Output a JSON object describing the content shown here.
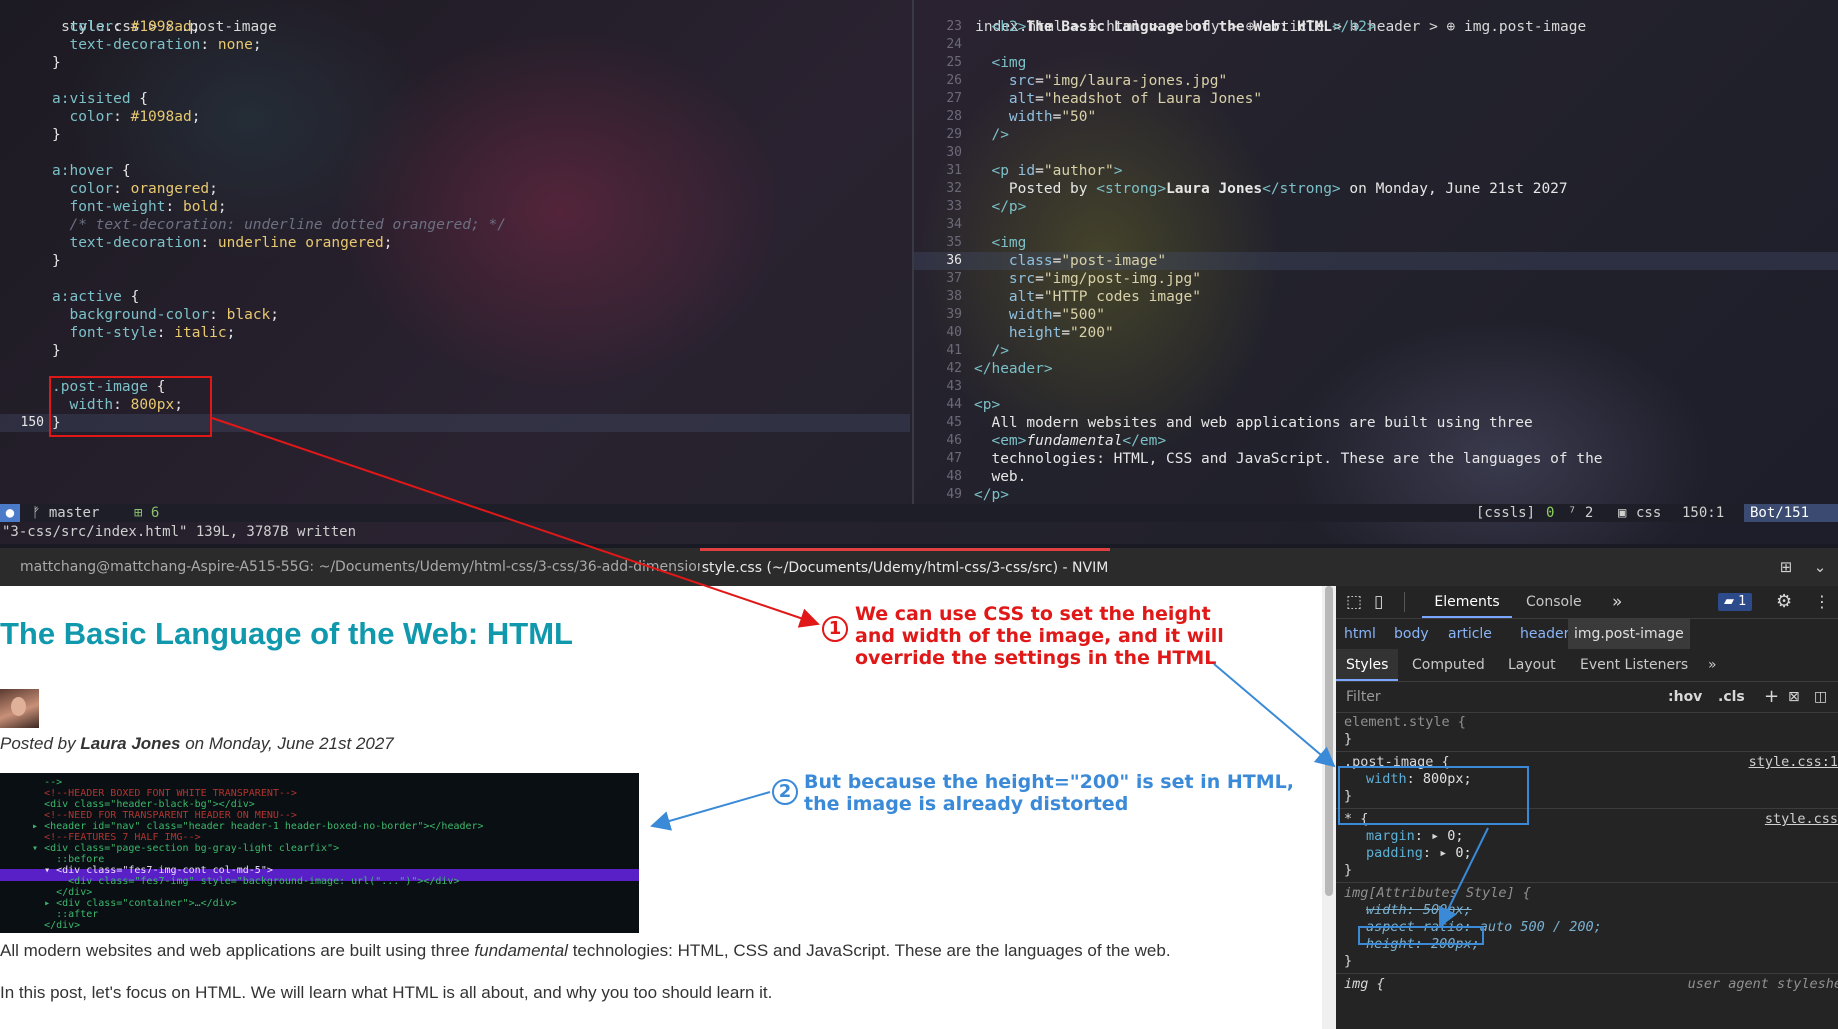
{
  "editor": {
    "left_pane": {
      "winbar": {
        "file": "style.css",
        "sep": ">",
        "num": "2",
        "crumb": ".post-image"
      },
      "lines": [
        {
          "n": "",
          "html": "  <span class='prop'>color</span>: <span class='val'>#1098ad</span>;"
        },
        {
          "n": "",
          "html": "  <span class='prop'>text-decoration</span>: <span class='val'>none</span>;"
        },
        {
          "n": "",
          "html": "}"
        },
        {
          "n": "",
          "html": ""
        },
        {
          "n": "",
          "html": "<span class='sel'>a:visited</span> {"
        },
        {
          "n": "",
          "html": "  <span class='prop'>color</span>: <span class='val'>#1098ad</span>;"
        },
        {
          "n": "",
          "html": "}"
        },
        {
          "n": "",
          "html": ""
        },
        {
          "n": "",
          "html": "<span class='sel'>a:hover</span> {"
        },
        {
          "n": "",
          "html": "  <span class='prop'>color</span>: <span class='val'>orangered</span>;"
        },
        {
          "n": "",
          "html": "  <span class='prop'>font-weight</span>: <span class='val'>bold</span>;"
        },
        {
          "n": "",
          "html": "  <span class='cmt'>/* text-decoration: underline dotted orangered; */</span>"
        },
        {
          "n": "",
          "html": "  <span class='prop'>text-decoration</span>: <span class='val'>underline orangered</span>;"
        },
        {
          "n": "",
          "html": "}"
        },
        {
          "n": "",
          "html": ""
        },
        {
          "n": "",
          "html": "<span class='sel'>a:active</span> {"
        },
        {
          "n": "",
          "html": "  <span class='prop'>background-color</span>: <span class='val'>black</span>;"
        },
        {
          "n": "",
          "html": "  <span class='prop'>font-style</span>: <span class='val'>italic</span>;"
        },
        {
          "n": "",
          "html": "}"
        },
        {
          "n": "",
          "html": ""
        },
        {
          "n": "",
          "html": "<span class='sel'>.post-image</span> {"
        },
        {
          "n": "",
          "html": "  <span class='prop'>width</span>: <span class='val'>800px</span>;"
        },
        {
          "n": "150",
          "html": "}",
          "current": true
        },
        {
          "n": "",
          "html": ""
        }
      ]
    },
    "right_pane": {
      "winbar": {
        "file": "index.html",
        "crumbs": "> ⊕ html > ⊕ body > ⊕ article > ⊕ header > ⊕ img.post-image"
      },
      "lines": [
        {
          "n": "23",
          "html": "  <span class='tag'>&lt;h2&gt;</span><span class='bold'>The Basic Language of the Web: HTML</span><span class='tag'>&lt;/h2&gt;</span>"
        },
        {
          "n": "24",
          "html": ""
        },
        {
          "n": "25",
          "html": "  <span class='tag'>&lt;img</span>"
        },
        {
          "n": "26",
          "html": "    <span class='attr'>src</span>=<span class='str'>\"img/laura-jones.jpg\"</span>"
        },
        {
          "n": "27",
          "html": "    <span class='attr'>alt</span>=<span class='str'>\"headshot of Laura Jones\"</span>"
        },
        {
          "n": "28",
          "html": "    <span class='attr'>width</span>=<span class='str'>\"50\"</span>"
        },
        {
          "n": "29",
          "html": "  <span class='tag'>/&gt;</span>"
        },
        {
          "n": "30",
          "html": ""
        },
        {
          "n": "31",
          "html": "  <span class='tag'>&lt;p</span> <span class='attr'>id</span>=<span class='str'>\"author\"</span><span class='tag'>&gt;</span>"
        },
        {
          "n": "32",
          "html": "    Posted by <span class='tag'>&lt;strong&gt;</span><span class='bold'>Laura Jones</span><span class='tag'>&lt;/strong&gt;</span> on Monday, June 21st 2027"
        },
        {
          "n": "33",
          "html": "  <span class='tag'>&lt;/p&gt;</span>"
        },
        {
          "n": "34",
          "html": ""
        },
        {
          "n": "35",
          "html": "  <span class='tag'>&lt;img</span>"
        },
        {
          "n": "36",
          "html": "    <span class='attr'>class</span>=<span class='str'>\"post-image\"</span>",
          "current": true
        },
        {
          "n": "37",
          "html": "    <span class='attr'>src</span>=<span class='str'>\"img/post-img.jpg\"</span>"
        },
        {
          "n": "38",
          "html": "    <span class='attr'>alt</span>=<span class='str'>\"HTTP codes image\"</span>"
        },
        {
          "n": "39",
          "html": "    <span class='attr'>width</span>=<span class='str'>\"500\"</span>"
        },
        {
          "n": "40",
          "html": "    <span class='attr'>height</span>=<span class='str'>\"200\"</span>"
        },
        {
          "n": "41",
          "html": "  <span class='tag'>/&gt;</span>"
        },
        {
          "n": "42",
          "html": "<span class='tag'>&lt;/header&gt;</span>"
        },
        {
          "n": "43",
          "html": ""
        },
        {
          "n": "44",
          "html": "<span class='tag'>&lt;p&gt;</span>"
        },
        {
          "n": "45",
          "html": "  All modern websites and web applications are built using three"
        },
        {
          "n": "46",
          "html": "  <span class='tag'>&lt;em&gt;</span><i>fundamental</i><span class='tag'>&lt;/em&gt;</span>"
        },
        {
          "n": "47",
          "html": "  technologies: HTML, CSS and JavaScript. These are the languages of the"
        },
        {
          "n": "48",
          "html": "  web."
        },
        {
          "n": "49",
          "html": "<span class='tag'>&lt;/p&gt;</span>"
        }
      ]
    },
    "statusline": {
      "branch": "ᚠ master",
      "changes": "⊞ 6",
      "lsp": "[cssls]",
      "zero": "0",
      "diag": "⁷ 2",
      "filetype": "css",
      "position": "150:1",
      "scroll": "Bot/151"
    },
    "cmdline": "\"3-css/src/index.html\" 139L, 3787B written"
  },
  "tabs": {
    "tab1": "mattchang@mattchang-Aspire-A515-55G: ~/Documents/Udemy/html-css/3-css/36-add-dimensions",
    "tab2": "style.css (~/Documents/Udemy/html-css/3-css/src) - NVIM"
  },
  "page": {
    "title": "The Basic Language of the Web: HTML",
    "byline_prefix": "Posted by ",
    "author": "Laura Jones",
    "byline_suffix": " on Monday, June 21st 2027",
    "p1_prefix": "All modern websites and web applications are built using three ",
    "p1_em": "fundamental",
    "p1_suffix": " technologies: HTML, CSS and JavaScript. These are the languages of the web.",
    "p2": "In this post, let's focus on HTML. We will learn what HTML is all about, and why you too should learn it.",
    "image_code_lines": [
      "    -->",
      "    <!--HEADER BOXED FONT WHITE TRANSPARENT-->",
      "    <div class=\"header-black-bg\"></div>",
      "    <!--NEED FOR TRANSPARENT HEADER ON MENU-->",
      "  ▸ <header id=\"nav\" class=\"header header-1 header-boxed-no-border\"></header>",
      "    <!--FEATURES 7 HALF IMG-->",
      "  ▾ <div class=\"page-section bg-gray-light clearfix\">",
      "      ::before",
      "    ▾ <div class=\"fes7-img-cont col-md-5\">",
      "        <div class=\"fes7-img\" style=\"background-image: url(\"...\")\"></div>",
      "      </div>",
      "    ▸ <div class=\"container\">…</div>",
      "      ::after",
      "    </div>"
    ]
  },
  "devtools": {
    "tabs": {
      "elements": "Elements",
      "console": "Console",
      "more": "»",
      "badge": "1"
    },
    "crumbs": [
      "html",
      "body",
      "article",
      "header",
      "img.post-image"
    ],
    "subtabs": [
      "Styles",
      "Computed",
      "Layout",
      "Event Listeners",
      "»"
    ],
    "filter": {
      "placeholder": "Filter",
      "hov": ":hov",
      "cls": ".cls",
      "plus": "+"
    },
    "rules": {
      "element_style": "element.style {",
      "post_image_selector": ".post-image {",
      "post_image_prop": "width",
      "post_image_val": "800px;",
      "post_image_src": "style.css:1",
      "star_selector": "* {",
      "star_src": "style.css",
      "margin_prop": "margin",
      "margin_val": "0;",
      "padding_prop": "padding",
      "padding_val": "0;",
      "attr_selector": "img[Attributes Style] {",
      "attr_width": "width: 500px;",
      "attr_aspect": "aspect-ratio: auto 500 / 200;",
      "attr_height": "height: 200px;",
      "img_selector": "img {",
      "img_src": "user agent styleshe",
      "close": "}"
    }
  },
  "annotations": {
    "one_num": "1",
    "one_line1": "We can use CSS to set the height",
    "one_line2": "and width of the image, and it will",
    "one_line3": "override the settings in the HTML",
    "two_num": "2",
    "two_line1": "But because the height=\"200\" is set in HTML,",
    "two_line2": "the image is already distorted",
    "colors": {
      "red": "#e01818",
      "blue": "#3a8ad8"
    }
  }
}
